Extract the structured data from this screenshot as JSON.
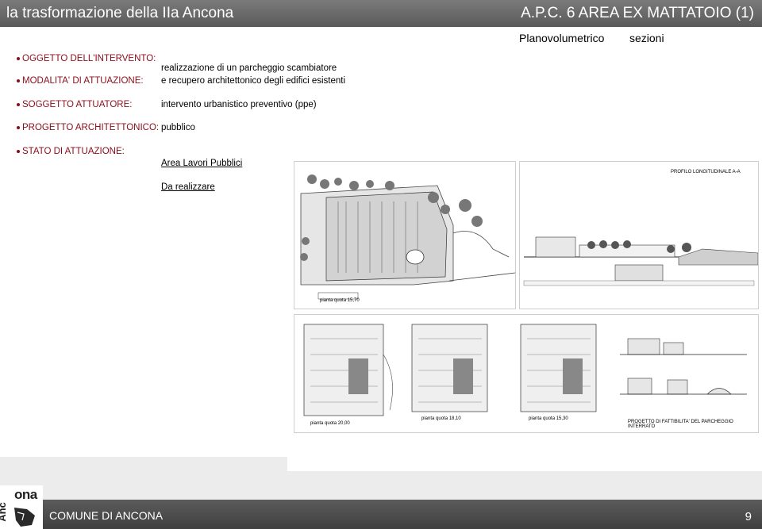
{
  "header": {
    "title": "la trasformazione della IIa Ancona",
    "code": "A.P.C. 6 AREA EX MATTATOIO (1)"
  },
  "tabs": {
    "planovolumetrico": "Planovolumetrico",
    "sezioni": "sezioni"
  },
  "fields": {
    "oggetto_label": "OGGETTO DELL'INTERVENTO:",
    "oggetto_value_1": "realizzazione di un parcheggio scambiatore",
    "oggetto_value_2": "e recupero architettonico degli edifici esistenti",
    "modalita_label": "MODALITA' DI ATTUAZIONE:",
    "modalita_value": "intervento urbanistico preventivo (ppe)",
    "soggetto_label": "SOGGETTO ATTUATORE:",
    "soggetto_value": "pubblico",
    "progetto_label": "PROGETTO ARCHITETTONICO:",
    "progetto_value": "Area Lavori Pubblici",
    "stato_label": "STATO DI ATTUAZIONE:",
    "stato_value": "Da realizzare"
  },
  "drawings": {
    "plan_caption": "pianta quota 15,70",
    "profile_caption": "PROFILO LONGITUDINALE A-A",
    "floor1_caption": "pianta quota 20,00",
    "floor2_caption": "pianta quota 18,10",
    "floor3_caption": "pianta quota 15,30",
    "sections_caption": "PROGETTO DI FATTIBILITA' DEL PARCHEGGIO INTERRATO"
  },
  "footer": {
    "logo_word": "ona",
    "logo_vertical": "Anc",
    "org": "COMUNE DI ANCONA",
    "page": "9"
  }
}
